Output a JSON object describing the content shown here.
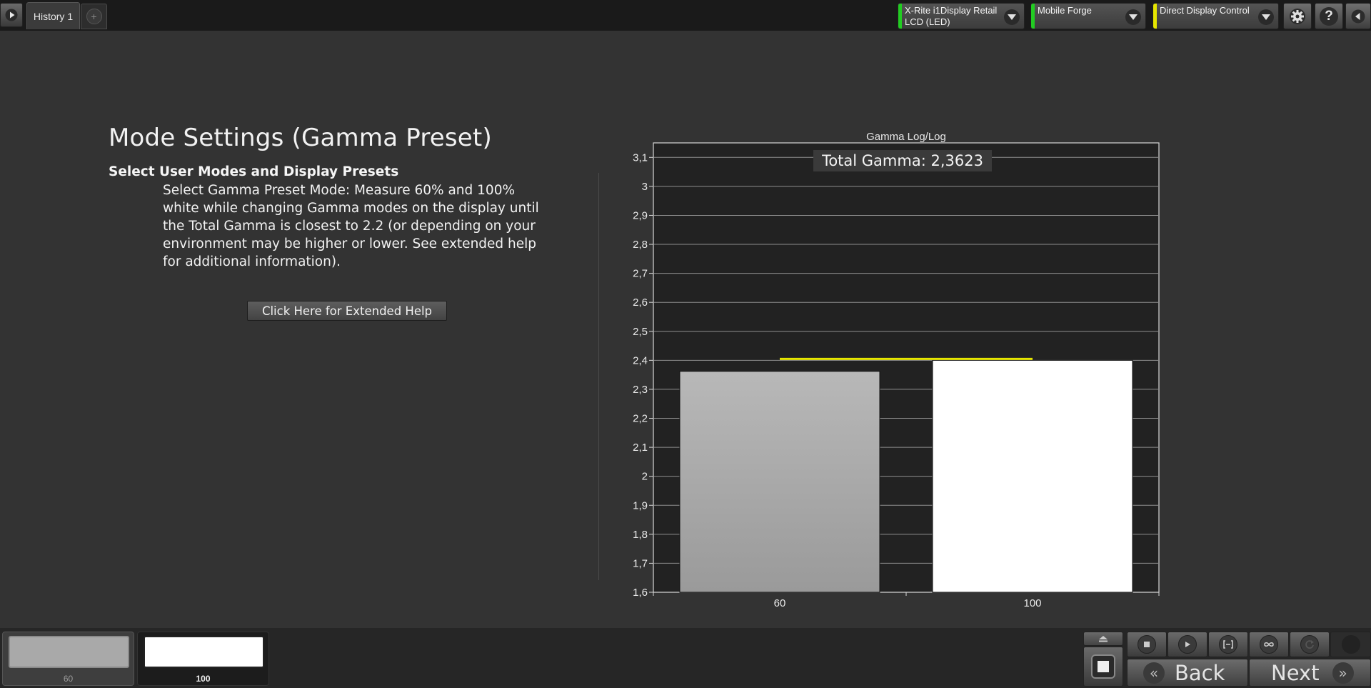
{
  "tabs": [
    {
      "label": "History 1"
    }
  ],
  "tab_add_label": "+",
  "devices": [
    {
      "line1": "X-Rite i1Display Retail",
      "line2": "LCD (LED)",
      "status_color": "#22cc22"
    },
    {
      "line1": "Mobile Forge",
      "line2": "",
      "status_color": "#22cc22"
    },
    {
      "line1": "Direct Display Control",
      "line2": "",
      "status_color": "#e6e600"
    }
  ],
  "toolbar": {
    "help_label": "?"
  },
  "main": {
    "title": "Mode Settings (Gamma Preset)",
    "subheading": "Select User Modes and Display Presets",
    "body": "Select Gamma Preset Mode: Measure 60% and 100% white while changing Gamma modes on the display until the Total Gamma is closest to 2.2 (or depending on your environment may be higher or lower. See extended help for additional information).",
    "extended_help_label": "Click Here for Extended Help"
  },
  "chart_data": {
    "type": "bar",
    "title": "Gamma Log/Log",
    "annotation": "Total Gamma: 2,3623",
    "categories": [
      "60",
      "100"
    ],
    "values": [
      2.362,
      2.4
    ],
    "bar_colors": [
      "#a8a8a8",
      "#ffffff"
    ],
    "target_line": 2.405,
    "target_color": "#e6e600",
    "ylim": [
      1.6,
      3.15
    ],
    "yticks": [
      "1,6",
      "1,7",
      "1,8",
      "1,9",
      "2",
      "2,1",
      "2,2",
      "2,3",
      "2,4",
      "2,5",
      "2,6",
      "2,7",
      "2,8",
      "2,9",
      "3",
      "3,1"
    ],
    "ytick_values": [
      1.6,
      1.7,
      1.8,
      1.9,
      2.0,
      2.1,
      2.2,
      2.3,
      2.4,
      2.5,
      2.6,
      2.7,
      2.8,
      2.9,
      3.0,
      3.1
    ],
    "grid": true
  },
  "patches": [
    {
      "label": "60",
      "color": "#a9a9a9"
    },
    {
      "label": "100",
      "color": "#ffffff"
    }
  ],
  "nav": {
    "back_label": "Back",
    "next_label": "Next"
  }
}
